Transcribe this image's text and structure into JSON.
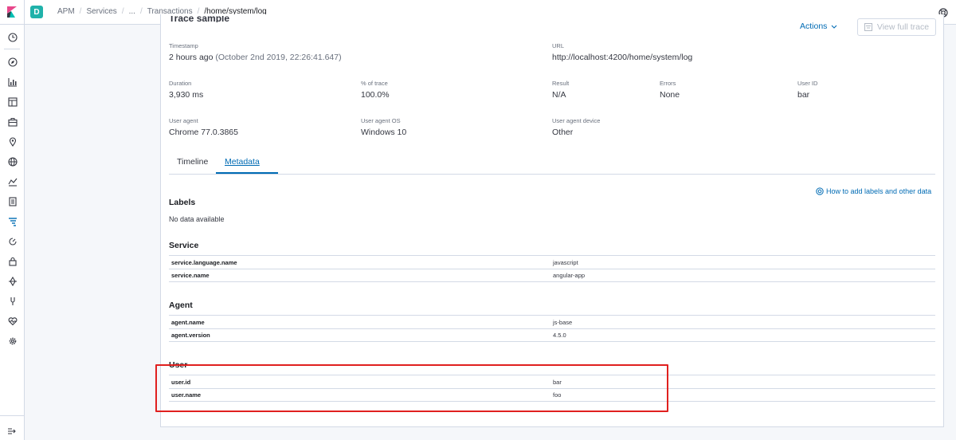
{
  "header": {
    "space_initial": "D",
    "breadcrumbs": [
      "APM",
      "Services",
      "...",
      "Transactions",
      "/home/system/log"
    ]
  },
  "panel": {
    "title": "Trace sample",
    "actions_label": "Actions",
    "view_trace_label": "View full trace"
  },
  "stats": {
    "timestamp_label": "Timestamp",
    "timestamp_value": "2 hours ago",
    "timestamp_detail": "(October 2nd 2019, 22:26:41.647)",
    "url_label": "URL",
    "url_value": "http://localhost:4200/home/system/log",
    "duration_label": "Duration",
    "duration_value": "3,930 ms",
    "percent_label": "% of trace",
    "percent_value": "100.0%",
    "result_label": "Result",
    "result_value": "N/A",
    "errors_label": "Errors",
    "errors_value": "None",
    "userid_label": "User ID",
    "userid_value": "bar",
    "useragent_label": "User agent",
    "useragent_value": "Chrome 77.0.3865",
    "useragent_os_label": "User agent OS",
    "useragent_os_value": "Windows 10",
    "useragent_device_label": "User agent device",
    "useragent_device_value": "Other"
  },
  "tabs": {
    "timeline": "Timeline",
    "metadata": "Metadata"
  },
  "help_link": "How to add labels and other data",
  "labels_section": {
    "title": "Labels",
    "empty": "No data available"
  },
  "service_section": {
    "title": "Service",
    "rows": [
      {
        "key": "service.language.name",
        "value": "javascript"
      },
      {
        "key": "service.name",
        "value": "angular-app"
      }
    ]
  },
  "agent_section": {
    "title": "Agent",
    "rows": [
      {
        "key": "agent.name",
        "value": "js-base"
      },
      {
        "key": "agent.version",
        "value": "4.5.0"
      }
    ]
  },
  "user_section": {
    "title": "User",
    "rows": [
      {
        "key": "user.id",
        "value": "bar"
      },
      {
        "key": "user.name",
        "value": "foo"
      }
    ]
  },
  "colors": {
    "accent": "#006bb4",
    "highlight": "#e0201f",
    "space_badge": "#20b2aa"
  },
  "icons": {
    "sidebar": [
      "clock-icon",
      "compass-icon",
      "bar-chart-icon",
      "dashboard-icon",
      "briefcase-icon",
      "map-pin-icon",
      "globe-icon",
      "ml-icon",
      "logs-icon",
      "apm-icon",
      "uptime-icon",
      "lock-icon",
      "dev-tools-icon",
      "stack-monitoring-icon",
      "heartbeat-icon",
      "gear-icon"
    ]
  }
}
